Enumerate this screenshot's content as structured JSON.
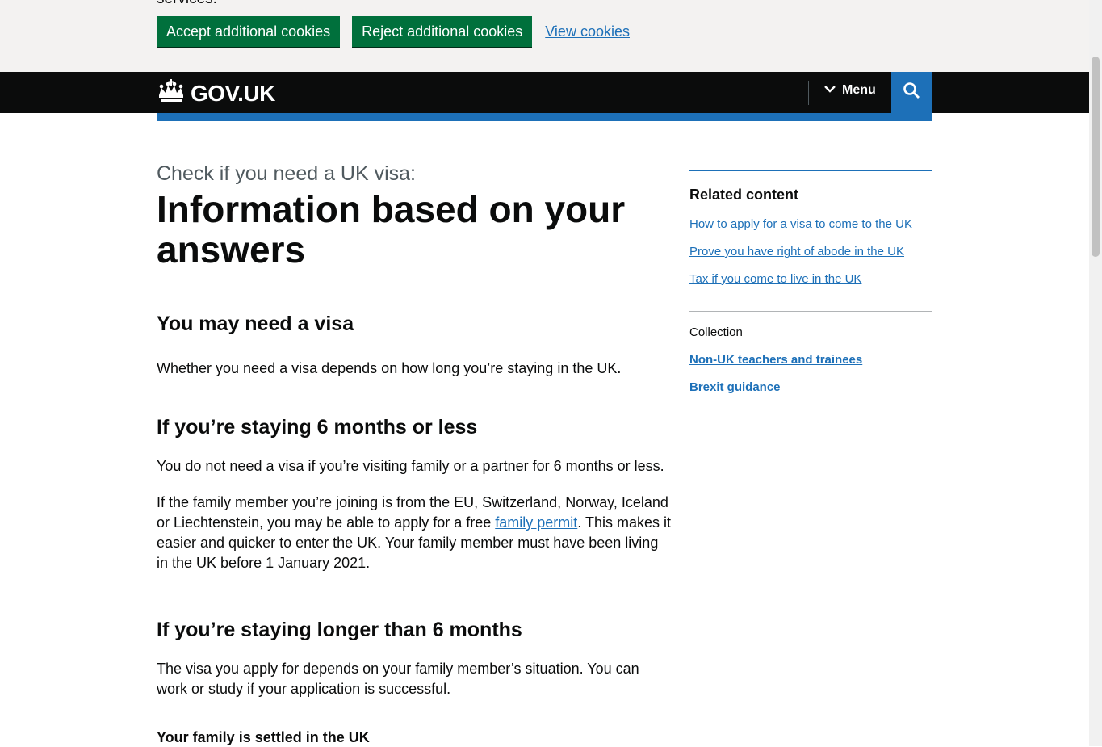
{
  "cookie_banner": {
    "clipped_text": "services.",
    "accept_label": "Accept additional cookies",
    "reject_label": "Reject additional cookies",
    "view_label": "View cookies"
  },
  "header": {
    "logo_text": "GOV.UK",
    "menu_label": "Menu"
  },
  "main": {
    "caption": "Check if you need a UK visa:",
    "title": "Information based on your answers",
    "sections": [
      {
        "heading": "You may need a visa",
        "paragraphs": [
          "Whether you need a visa depends on how long you’re staying in the UK."
        ]
      },
      {
        "heading": "If you’re staying 6 months or less",
        "p1": "You do not need a visa if you’re visiting family or a partner for 6 months or less.",
        "p2_before": "If the family member you’re joining is from the EU, Switzerland, Norway, Iceland or Liechtenstein, you may be able to apply for a free ",
        "p2_link": "family permit",
        "p2_after": ". This makes it easier and quicker to enter the UK. Your family member must have been living in the UK before 1 January 2021."
      },
      {
        "heading": "If you’re staying longer than 6 months",
        "p1": "The visa you apply for depends on your family member’s situation. You can work or study if your application is successful.",
        "subheading": "Your family is settled in the UK"
      }
    ]
  },
  "sidebar": {
    "heading": "Related content",
    "links": [
      "How to apply for a visa to come to the UK",
      "Prove you have right of abode in the UK",
      "Tax if you come to live in the UK"
    ],
    "collection_label": "Collection",
    "collection_links": [
      "Non-UK teachers and trainees",
      "Brexit guidance"
    ]
  },
  "colors": {
    "brand_blue": "#1d70b8",
    "button_green": "#00703c",
    "header_black": "#0b0c0c",
    "banner_grey": "#f3f2f1"
  },
  "icons": {
    "logo": "crown-icon",
    "menu": "chevron-down-icon",
    "search": "search-icon"
  }
}
